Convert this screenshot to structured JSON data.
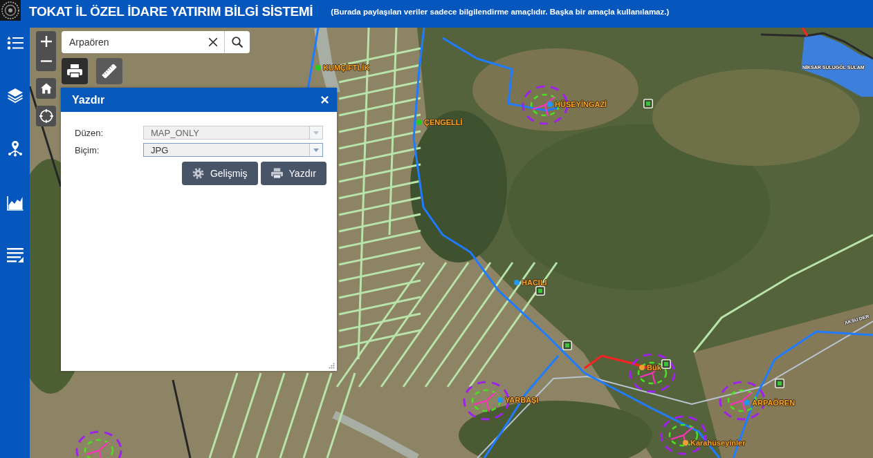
{
  "header": {
    "title": "TOKAT İL ÖZEL İDARE YATIRIM BİLGİ SİSTEMİ",
    "notice": "(Burada paylaşılan veriler sadece bilgilendirme amaçlıdır. Başka bir amaçla kullanılamaz.)"
  },
  "search": {
    "value": "Arpaören"
  },
  "tools": [
    {
      "selected": true
    },
    {
      "selected": false
    }
  ],
  "print_dialog": {
    "title": "Yazdır",
    "fields": [
      {
        "label": "Düzen:",
        "value": "MAP_ONLY",
        "disabled": true,
        "focused": false
      },
      {
        "label": "Biçim:",
        "value": "JPG",
        "disabled": false,
        "focused": true
      }
    ],
    "buttons": [
      "Gelişmiş",
      "Yazdır"
    ]
  },
  "map": {
    "places": [
      {
        "name": "KUMÇİFTLİK",
        "color": "#22cc22"
      },
      {
        "name": "ÇENGELLİ",
        "color": "#22cc22"
      },
      {
        "name": "HÜSEYİNGAZİ",
        "color": "#2196f3"
      },
      {
        "name": "HACILI",
        "color": "#2196f3"
      },
      {
        "name": "Bük",
        "color": "#f0a030"
      },
      {
        "name": "YARBAŞI",
        "color": "#2196f3"
      },
      {
        "name": "ARPAÖREN",
        "color": "#2196f3"
      },
      {
        "name": "Karahüseyinler",
        "color": "#f0a030"
      }
    ],
    "water_labels": [
      "NİKSAR SULUGÖL SULAM",
      "AKSU DER"
    ]
  }
}
